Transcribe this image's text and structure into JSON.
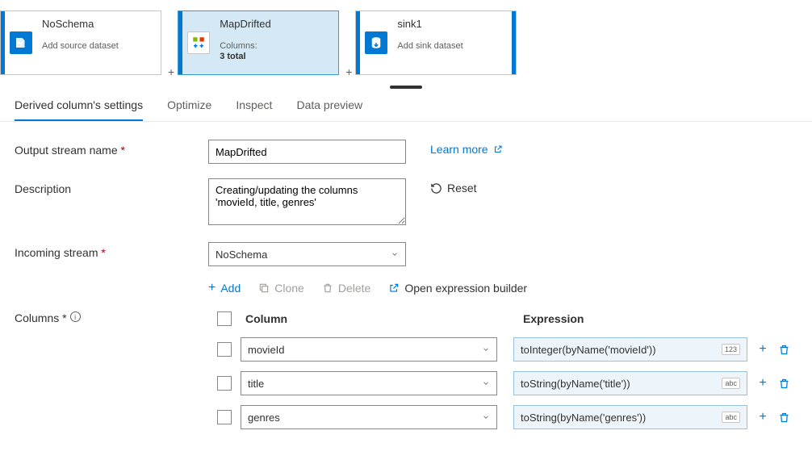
{
  "flow": {
    "nodes": [
      {
        "title": "NoSchema",
        "sub_label": "Add source dataset"
      },
      {
        "title": "MapDrifted",
        "sub_label": "Columns:",
        "sub_value": "3 total"
      },
      {
        "title": "sink1",
        "sub_label": "Add sink dataset"
      }
    ]
  },
  "tabs": {
    "settings": "Derived column's settings",
    "optimize": "Optimize",
    "inspect": "Inspect",
    "preview": "Data preview"
  },
  "form": {
    "output_label": "Output stream name",
    "output_value": "MapDrifted",
    "learn_more": "Learn more",
    "desc_label": "Description",
    "desc_value": "Creating/updating the columns 'movieId, title, genres'",
    "reset": "Reset",
    "incoming_label": "Incoming stream",
    "incoming_value": "NoSchema",
    "columns_label": "Columns"
  },
  "toolbar": {
    "add": "Add",
    "clone": "Clone",
    "delete": "Delete",
    "open_builder": "Open expression builder"
  },
  "table": {
    "col_header": "Column",
    "expr_header": "Expression",
    "rows": [
      {
        "column": "movieId",
        "expression": "toInteger(byName('movieId'))",
        "badge": "123"
      },
      {
        "column": "title",
        "expression": "toString(byName('title'))",
        "badge": "abc"
      },
      {
        "column": "genres",
        "expression": "toString(byName('genres'))",
        "badge": "abc"
      }
    ]
  },
  "chart_data": {
    "type": "table",
    "title": "Derived columns",
    "columns": [
      "Column",
      "Expression"
    ],
    "rows": [
      [
        "movieId",
        "toInteger(byName('movieId'))"
      ],
      [
        "title",
        "toString(byName('title'))"
      ],
      [
        "genres",
        "toString(byName('genres'))"
      ]
    ]
  }
}
